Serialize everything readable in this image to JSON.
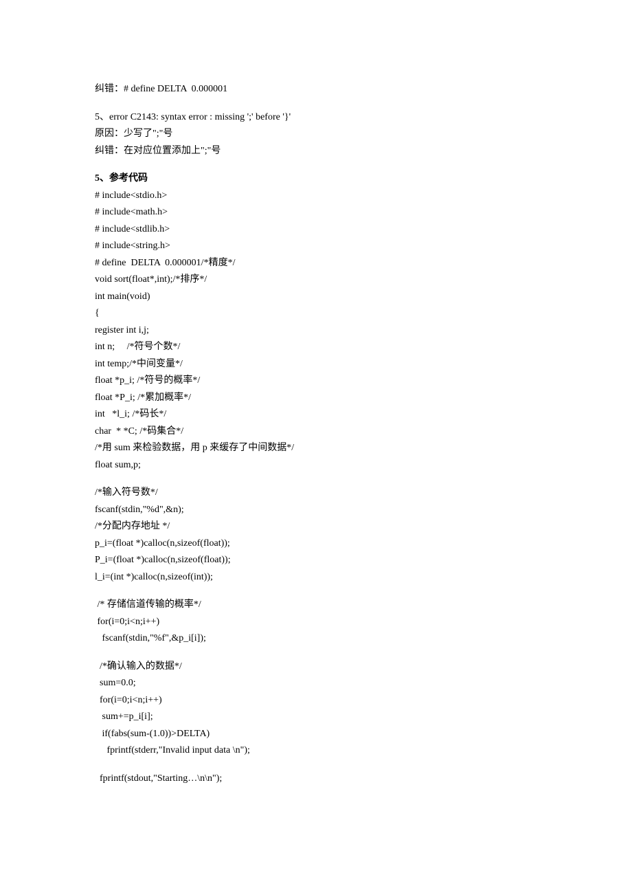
{
  "line_correction1": "纠错：# define DELTA  0.000001",
  "err_block_l1": "5、error C2143: syntax error : missing ';' before '}'",
  "err_block_l2": "原因：少写了\";\"号",
  "err_block_l3": "纠错：在对应位置添加上\";\"号",
  "heading": "5、参考代码",
  "code_block1": "# include<stdio.h>\n# include<math.h>\n# include<stdlib.h>\n# include<string.h>\n# define  DELTA  0.000001/*精度*/\nvoid sort(float*,int);/*排序*/\nint main(void)\n{\nregister int i,j;\nint n;     /*符号个数*/\nint temp;/*中间变量*/\nfloat *p_i; /*符号的概率*/\nfloat *P_i; /*累加概率*/\nint   *l_i; /*码长*/\nchar  * *C; /*码集合*/\n/*用 sum 来检验数据，用 p 来缓存了中间数据*/\nfloat sum,p;",
  "code_block2": "/*输入符号数*/\nfscanf(stdin,\"%d\",&n);\n/*分配内存地址 */\np_i=(float *)calloc(n,sizeof(float));\nP_i=(float *)calloc(n,sizeof(float));\nl_i=(int *)calloc(n,sizeof(int));",
  "code_block3": " /* 存储信道传输的概率*/\n for(i=0;i<n;i++)\n   fscanf(stdin,\"%f\",&p_i[i]);",
  "code_block4": "  /*确认输入的数据*/\n  sum=0.0;\n  for(i=0;i<n;i++)\n   sum+=p_i[i];\n   if(fabs(sum-(1.0))>DELTA)\n     fprintf(stderr,\"Invalid input data \\n\");",
  "code_block5": "  fprintf(stdout,\"Starting…\\n\\n\");"
}
